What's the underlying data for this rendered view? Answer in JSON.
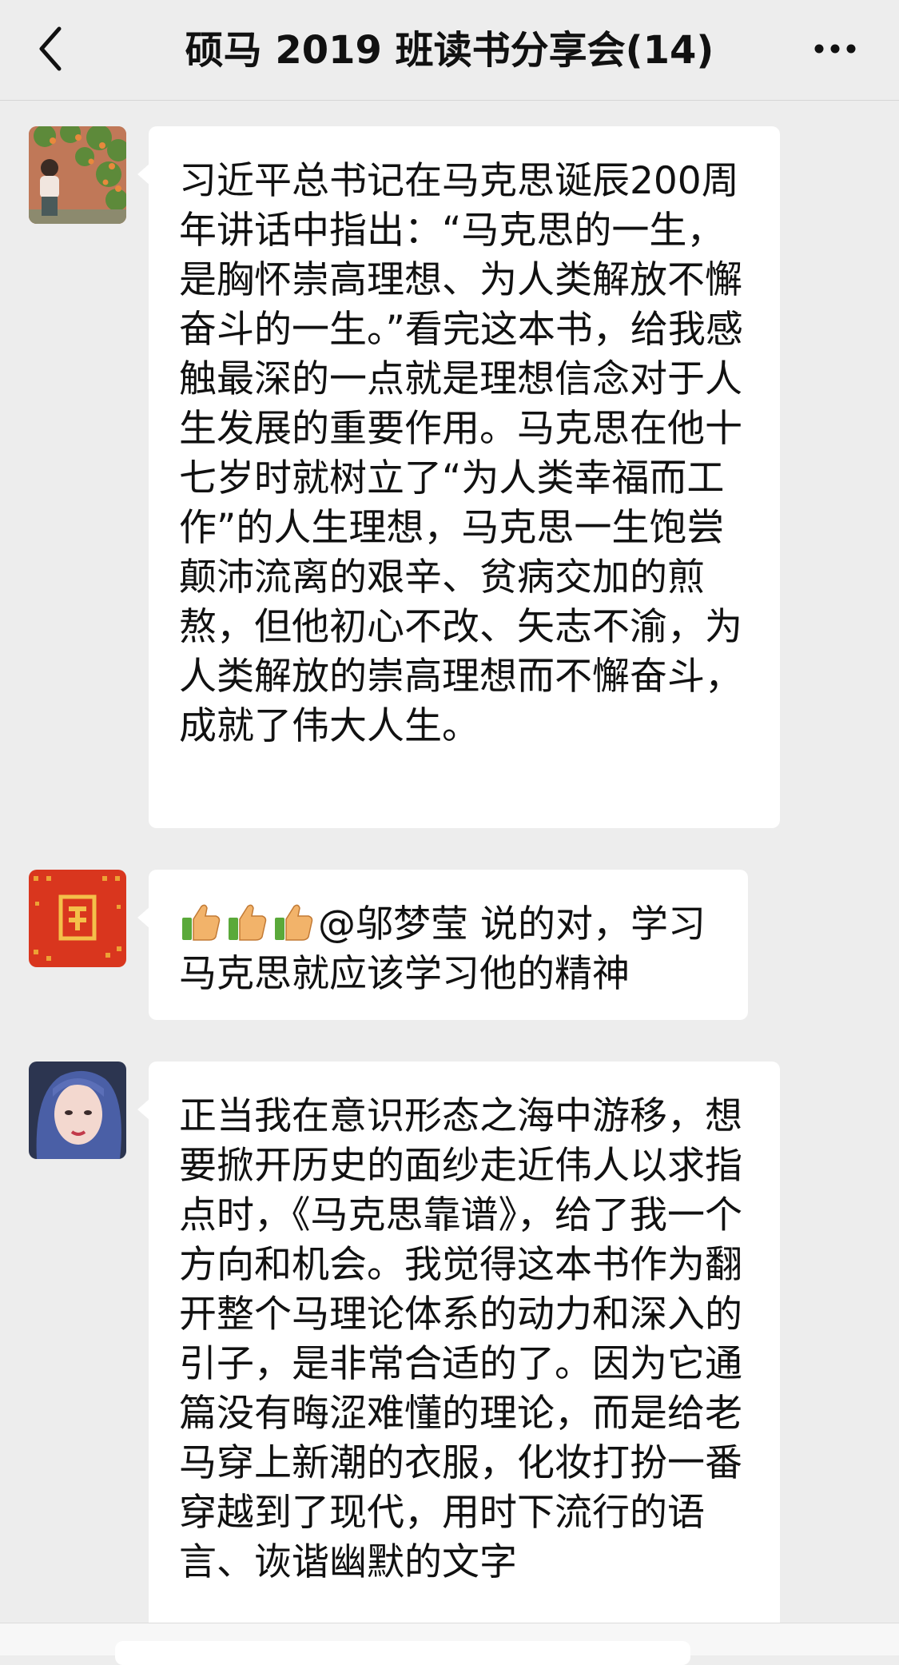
{
  "header": {
    "title": "硕马 2019 班读书分享会(14)",
    "back_icon": "chevron-left-icon",
    "more_icon": "more-dots-icon"
  },
  "messages": [
    {
      "avatar": "avatar-girl-flower-wall",
      "text": "习近平总书记在马克思诞辰200周年讲话中指出：“马克思的一生，是胸怀崇高理想、为人类解放不懈奋斗的一生。”看完这本书，给我感触最深的一点就是理想信念对于人生发展的重要作用。马克思在他十七岁时就树立了“为人类幸福而工作”的人生理想，马克思一生饱尝颠沛流离的艰辛、贫病交加的煎熬，但他初心不改、矢志不渝，为人类解放的崇高理想而不懈奋斗，成就了伟大人生。"
    },
    {
      "avatar": "avatar-red-pattern",
      "text": "@邬梦莹 说的对，学习马克思就应该学习他的精神",
      "emoji_count": 3,
      "emoji": "thumbs-up-icon"
    },
    {
      "avatar": "avatar-girl-blue-hair",
      "text": "正当我在意识形态之海中游移，想要掀开历史的面纱走近伟人以求指点时，《马克思靠谱》，给了我一个方向和机会。我觉得这本书作为翻开整个马理论体系的动力和深入的引子，是非常合适的了。因为它通篇没有晦涩难懂的理论，而是给老马穿上新潮的衣服，化妆打扮一番穿越到了现代，用时下流行的语言、诙谐幽默的文字"
    }
  ],
  "colors": {
    "background": "#ededed",
    "bubble": "#ffffff",
    "text": "#111111"
  }
}
